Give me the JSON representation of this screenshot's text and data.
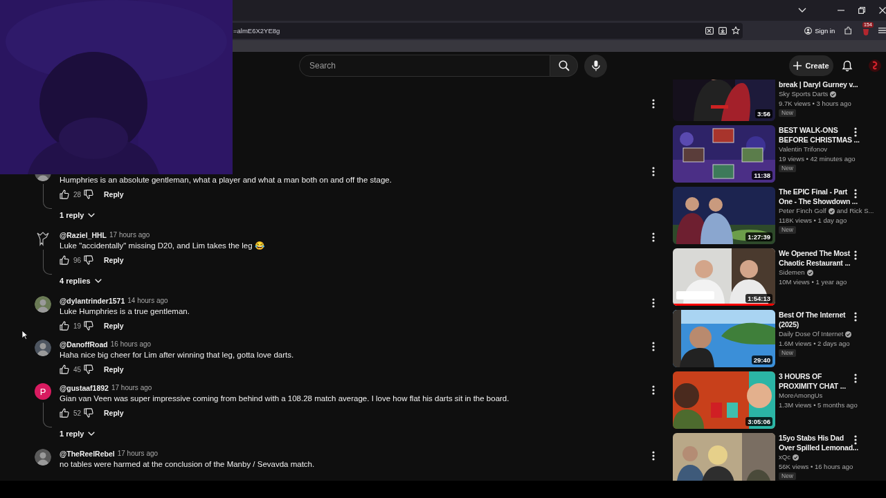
{
  "browser": {
    "url": "=almE6X2YE8g",
    "sign_in": "Sign in",
    "extension_badge": "154"
  },
  "masthead": {
    "search": {
      "placeholder": "Search"
    },
    "create": "Create"
  },
  "comments": [
    {
      "text": "Humphries is an absolute gentleman, what a player and what a man both on and off the stage.",
      "likes": "28",
      "reply": "Reply",
      "replies": "1 reply"
    },
    {
      "author": "@Raziel_HHL",
      "time": "17 hours ago",
      "avatar": {
        "kind": "emblem"
      },
      "text": "Luke \"accidentally\" missing D20, and Lim takes the leg 😂",
      "likes": "96",
      "reply": "Reply",
      "replies": "4 replies"
    },
    {
      "author": "@dylantrinder1571",
      "time": "14 hours ago",
      "text": "Luke Humphries is a true gentleman.",
      "likes": "19",
      "reply": "Reply"
    },
    {
      "author": "@DanoffRoad",
      "time": "16 hours ago",
      "text": "Haha nice big cheer for Lim after winning that leg, gotta love darts.",
      "likes": "45",
      "reply": "Reply"
    },
    {
      "author": "@gustaaf1892",
      "time": "17 hours ago",
      "avatar": {
        "kind": "letter",
        "letter": "P",
        "color": "#d81b60"
      },
      "text": "Gian van Veen was super impressive coming from behind with a 108.28 match average. I love how flat his darts sit in the board.",
      "likes": "52",
      "reply": "Reply",
      "replies": "1 reply"
    },
    {
      "author": "@TheReelRebel",
      "time": "17 hours ago",
      "text": "no tables were harmed at the conclusion of the Manby / Sevavda match."
    }
  ],
  "videos": [
    {
      "title_lines": [
        "break | Daryl Gurney v..."
      ],
      "title_cut_top": true,
      "channel": "Sky Sports Darts",
      "verified": true,
      "meta": "9.7K views • 3 hours ago",
      "new_badge": "New",
      "duration": "3:56"
    },
    {
      "title_lines": [
        "BEST WALK-ONS",
        "BEFORE CHRISTMAS ..."
      ],
      "channel": "Valentin Trifonov",
      "verified": false,
      "meta": "19 views • 42 minutes ago",
      "new_badge": "New",
      "duration": "11:38"
    },
    {
      "title_lines": [
        "The EPIC Final - Part",
        "One - The Showdown ..."
      ],
      "channel": "Peter Finch Golf",
      "verified": true,
      "channel_extra": "and Rick S...",
      "meta": "118K views • 1 day ago",
      "new_badge": "New",
      "duration": "1:27:39"
    },
    {
      "title_lines": [
        "We Opened The Most",
        "Chaotic Restaurant ..."
      ],
      "channel": "Sidemen",
      "verified": true,
      "meta": "10M views • 1 year ago",
      "duration": "1:54:13",
      "level": 1
    },
    {
      "title_lines": [
        "Best Of The Internet",
        "(2025)"
      ],
      "channel": "Daily Dose Of Internet",
      "verified": true,
      "meta": "1.6M views • 2 days ago",
      "new_badge": "New",
      "duration": "29:40"
    },
    {
      "title_lines": [
        "3 HOURS OF",
        "PROXIMITY CHAT ..."
      ],
      "channel": "MoreAmongUs",
      "verified": false,
      "meta": "1.3M views • 5 months ago",
      "duration": "3:05:06"
    },
    {
      "title_lines": [
        "15yo Stabs His Dad",
        "Over Spilled Lemonad..."
      ],
      "channel": "xQc",
      "verified": true,
      "meta": "56K views • 16 hours ago",
      "new_badge": "New"
    }
  ]
}
